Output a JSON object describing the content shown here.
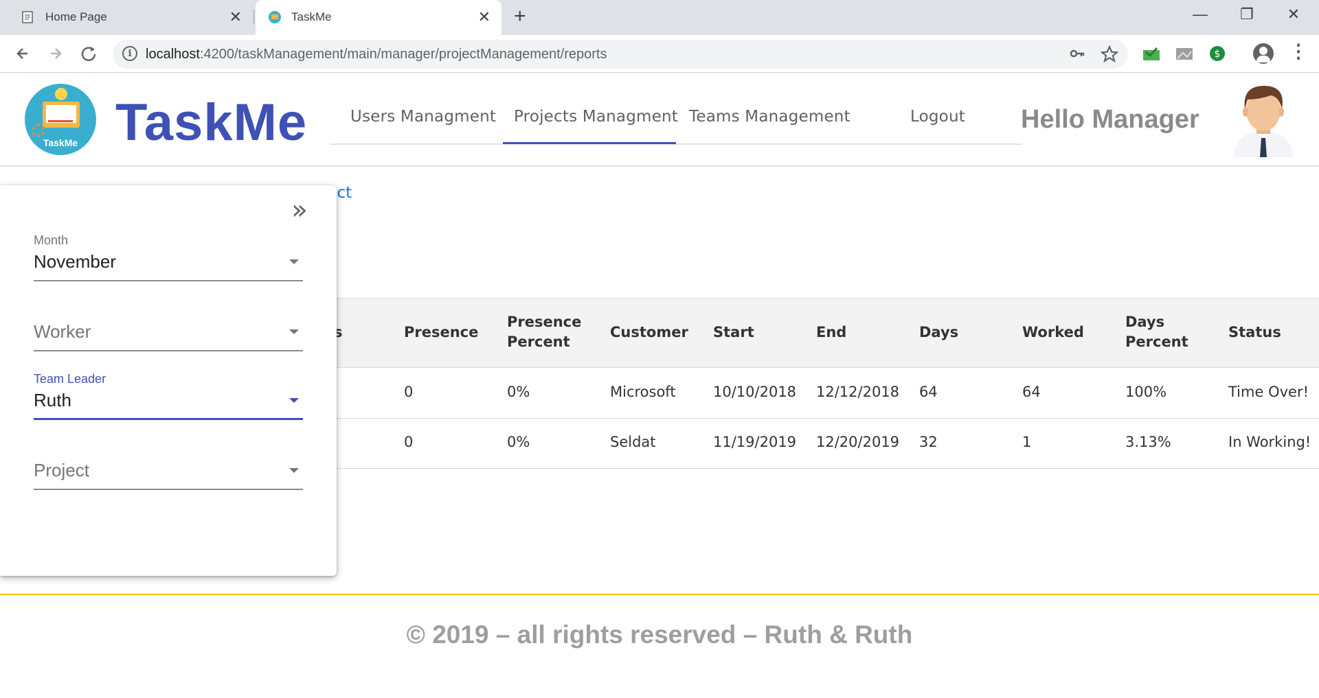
{
  "browser": {
    "tabs": [
      {
        "title": "Home Page",
        "close": "✕"
      },
      {
        "title": "TaskMe",
        "close": "✕"
      }
    ],
    "new_tab": "+",
    "window_controls": {
      "minimize": "—",
      "restore": "❐",
      "close": "✕"
    },
    "url_host": "localhost",
    "url_rest": ":4200/taskManagement/main/manager/projectManagement/reports",
    "icons": {
      "back": "arrow-left",
      "forward": "arrow-right",
      "reload": "reload",
      "info": "info",
      "key": "key",
      "star": "star",
      "menu": "kebab"
    }
  },
  "header": {
    "logo_text": "TaskMe",
    "brand": "TaskMe",
    "nav": [
      "Users Managment",
      "Projects Managment",
      "Teams Management",
      "Logout"
    ],
    "active_nav": "Projects Managment",
    "greeting": "Hello Manager"
  },
  "content": {
    "link_text": "ject",
    "table": {
      "headers": [
        [
          "s"
        ],
        [
          "Presence"
        ],
        [
          "Presence",
          "Percent"
        ],
        [
          "Customer"
        ],
        [
          "Start"
        ],
        [
          "End"
        ],
        [
          "Days"
        ],
        [
          "Worked"
        ],
        [
          "Days",
          "Percent"
        ],
        [
          "Status"
        ]
      ],
      "rows": [
        [
          "0",
          "0%",
          "Microsoft",
          "10/10/2018",
          "12/12/2018",
          "64",
          "64",
          "100%",
          "Time Over!"
        ],
        [
          "0",
          "0%",
          "Seldat",
          "11/19/2019",
          "12/20/2019",
          "32",
          "1",
          "3.13%",
          "In Working!"
        ]
      ]
    }
  },
  "filters": {
    "collapse_icon": "»",
    "month": {
      "label": "Month",
      "value": "November"
    },
    "worker": {
      "placeholder": "Worker"
    },
    "team_leader": {
      "label": "Team Leader",
      "value": "Ruth"
    },
    "project": {
      "placeholder": "Project"
    }
  },
  "footer": {
    "text": "© 2019 – all rights reserved – Ruth & Ruth"
  },
  "colors": {
    "accent": "#3f51b5",
    "link": "#1976d2",
    "footer_line": "#f1c40f"
  }
}
